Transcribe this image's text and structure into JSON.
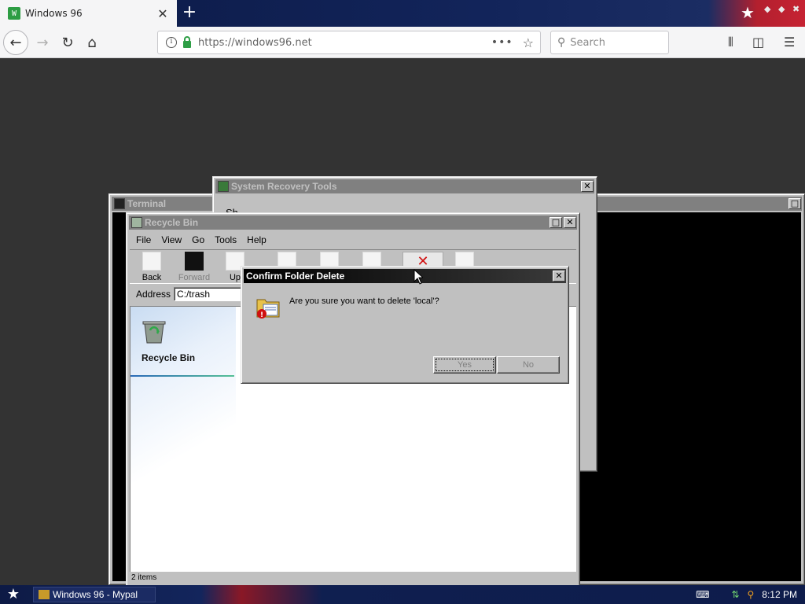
{
  "browser": {
    "tab_title": "Windows 96",
    "favicon_text": "W",
    "tab_close": "✕",
    "new_tab": "+",
    "url": "https://windows96.net",
    "search_placeholder": "Search"
  },
  "terminal": {
    "title": "Terminal"
  },
  "system_recovery": {
    "title": "System Recovery Tools",
    "partial_text": "Sh"
  },
  "recycle_bin": {
    "title": "Recycle Bin",
    "menu": [
      "File",
      "View",
      "Go",
      "Tools",
      "Help"
    ],
    "toolbar": {
      "back": "Back",
      "forward": "Forward",
      "up": "Up"
    },
    "address_label": "Address",
    "address_value": "C:/trash",
    "side_title": "Recycle Bin",
    "status": "2 items"
  },
  "dialog": {
    "title": "Confirm Folder Delete",
    "message": "Are you sure you want to delete 'local'?",
    "yes_label": "Yes",
    "no_label": "No"
  },
  "taskbar": {
    "task_label": "Windows 96 - Mypal",
    "clock": "8:12 PM"
  },
  "colors": {
    "desktop_bg": "#333333",
    "window_face": "#c0c0c0",
    "taskbar_bg": "#0f1f50"
  }
}
